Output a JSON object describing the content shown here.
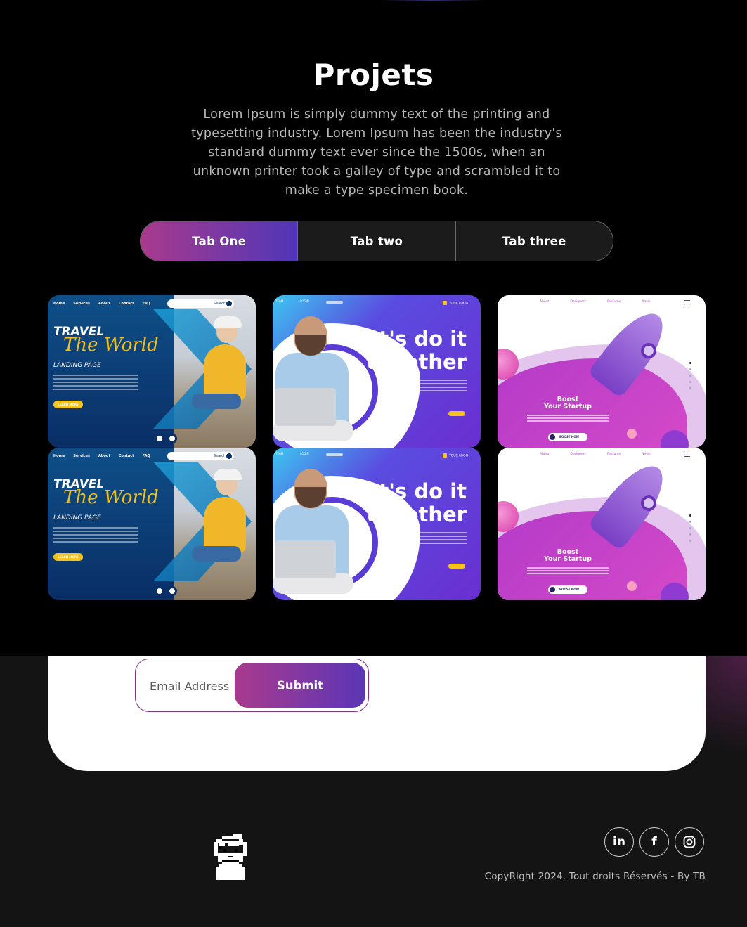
{
  "projects": {
    "title": "Projets",
    "description": "Lorem Ipsum is simply dummy text of the printing and typesetting industry. Lorem Ipsum has been the industry's standard dummy text ever since the 1500s, when an unknown printer took a galley of type and scrambled it to make a type specimen book.",
    "tabs": [
      {
        "label": "Tab One",
        "active": true
      },
      {
        "label": "Tab two",
        "active": false
      },
      {
        "label": "Tab three",
        "active": false
      }
    ],
    "cards": [
      {
        "kind": "travel",
        "nav": [
          "Home",
          "Services",
          "About",
          "Contact",
          "FAQ"
        ],
        "search": "Search",
        "line1": "TRAVEL",
        "line2": "The World",
        "line3": "LANDING PAGE",
        "button": "LEARN MORE"
      },
      {
        "kind": "together",
        "headline_1": "let's do it",
        "headline_2": "together",
        "logo": "YOUR LOGO",
        "nav": [
          "TEAM",
          "LOGIN"
        ]
      },
      {
        "kind": "rocket",
        "nav": [
          "About",
          "Designers",
          "Features",
          "News"
        ],
        "headline_1": "Boost",
        "headline_2": "Your Startup",
        "button": "BOOST NOW"
      }
    ]
  },
  "newsletter": {
    "email_placeholder": "Email Address",
    "submit_label": "Submit"
  },
  "footer": {
    "socials": [
      {
        "icon": "linkedin-icon",
        "glyph": "in"
      },
      {
        "icon": "facebook-icon",
        "glyph": "f"
      },
      {
        "icon": "instagram-icon",
        "glyph": ""
      }
    ],
    "copyright": "CopyRight 2024. Tout droits Réservés - By TB"
  },
  "colors": {
    "accent_start": "#a93a8d",
    "accent_end": "#4f36b8",
    "page_bg": "#000000",
    "footer_bg": "#141414"
  }
}
